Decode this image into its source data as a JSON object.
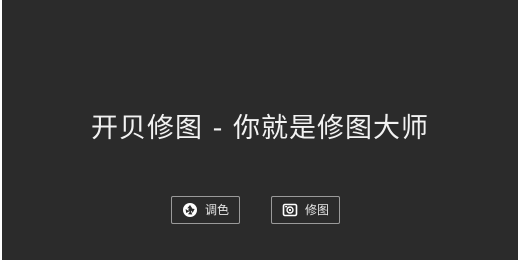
{
  "headline": "开贝修图 - 你就是修图大师",
  "buttons": {
    "adjust": {
      "label": "调色",
      "icon": "aperture-icon"
    },
    "retouch": {
      "label": "修图",
      "icon": "photo-frame-icon"
    }
  },
  "colors": {
    "background": "#2b2b2b",
    "text": "#f2f2f2",
    "button_border": "#9a9a9a"
  }
}
